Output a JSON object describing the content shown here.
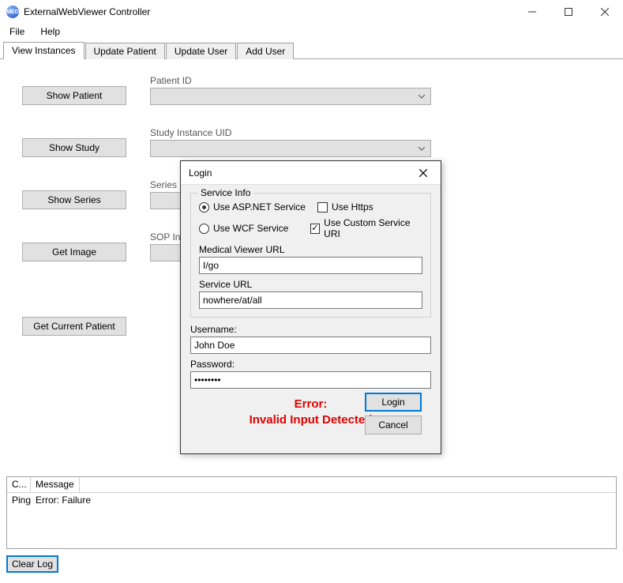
{
  "window": {
    "title": "ExternalWebViewer Controller"
  },
  "menu": {
    "file": "File",
    "help": "Help"
  },
  "tabs": [
    {
      "label": "View Instances",
      "active": true
    },
    {
      "label": "Update Patient",
      "active": false
    },
    {
      "label": "Update User",
      "active": false
    },
    {
      "label": "Add User",
      "active": false
    }
  ],
  "view": {
    "rows": [
      {
        "button": "Show Patient",
        "label": "Patient ID",
        "value": ""
      },
      {
        "button": "Show Study",
        "label": "Study Instance UID",
        "value": ""
      },
      {
        "button": "Show Series",
        "label": "Series Instance UID",
        "value": ""
      },
      {
        "button": "Get Image",
        "label": "SOP Instance UID",
        "value": ""
      }
    ],
    "get_current_patient": "Get Current Patient"
  },
  "log": {
    "columns": [
      "C...",
      "Message"
    ],
    "rows": [
      {
        "c": "Ping",
        "msg": "Error: Failure"
      }
    ],
    "clear_button": "Clear Log"
  },
  "dialog": {
    "title": "Login",
    "group_title": "Service Info",
    "radio_asp": "Use ASP.NET Service",
    "radio_wcf": "Use WCF Service",
    "check_https": "Use Https",
    "check_custom_uri": "Use Custom Service URI",
    "radio_selected": "asp",
    "https_checked": false,
    "custom_uri_checked": true,
    "medical_viewer_url_label": "Medical Viewer URL",
    "medical_viewer_url": "I/go",
    "service_url_label": "Service URL",
    "service_url": "nowhere/at/all",
    "username_label": "Username:",
    "username": "John Doe",
    "password_label": "Password:",
    "password": "••••••••",
    "error_line1": "Error:",
    "error_line2": "Invalid Input Detected",
    "login_btn": "Login",
    "cancel_btn": "Cancel"
  }
}
